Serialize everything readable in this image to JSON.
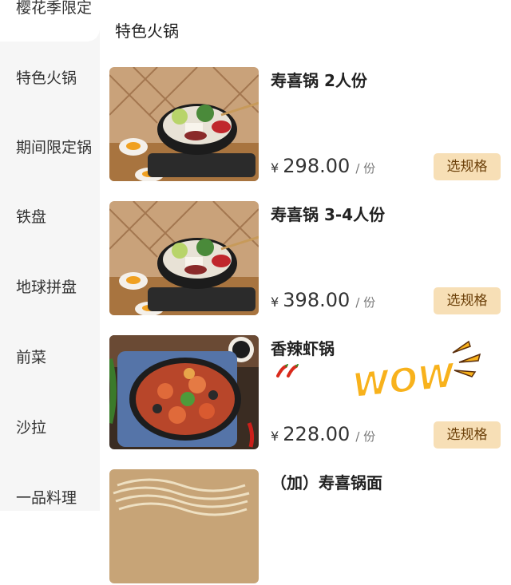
{
  "sidebar": {
    "items": [
      {
        "label": "樱花季限定"
      },
      {
        "label": "特色火锅"
      },
      {
        "label": "期间限定锅"
      },
      {
        "label": "铁盘"
      },
      {
        "label": "地球拼盘"
      },
      {
        "label": "前菜"
      },
      {
        "label": "沙拉"
      },
      {
        "label": "一品料理"
      }
    ]
  },
  "main": {
    "section_title": "特色火锅",
    "dishes": [
      {
        "name": "寿喜锅 2人份",
        "currency": "¥",
        "price": "298.00",
        "unit": "/ 份",
        "button": "选规格",
        "image": "sukiyaki-pot-photo"
      },
      {
        "name": "寿喜锅 3-4人份",
        "currency": "¥",
        "price": "398.00",
        "unit": "/ 份",
        "button": "选规格",
        "image": "sukiyaki-pot-photo"
      },
      {
        "name": "香辣虾锅",
        "currency": "¥",
        "price": "228.00",
        "unit": "/ 份",
        "button": "选规格",
        "image": "spicy-shrimp-pot-photo",
        "badges": [
          "chili-icon",
          "chili-icon"
        ],
        "sticker": "WOW"
      },
      {
        "name": "（加）寿喜锅面",
        "image": "noodles-photo"
      }
    ]
  },
  "colors": {
    "sidebar_bg": "#f6f6f6",
    "button_bg": "#f7dfb6",
    "button_text": "#6b3f08",
    "wow_fill": "#f8b21c",
    "wow_stroke": "#ffffff",
    "chili": "#d92a1c"
  }
}
